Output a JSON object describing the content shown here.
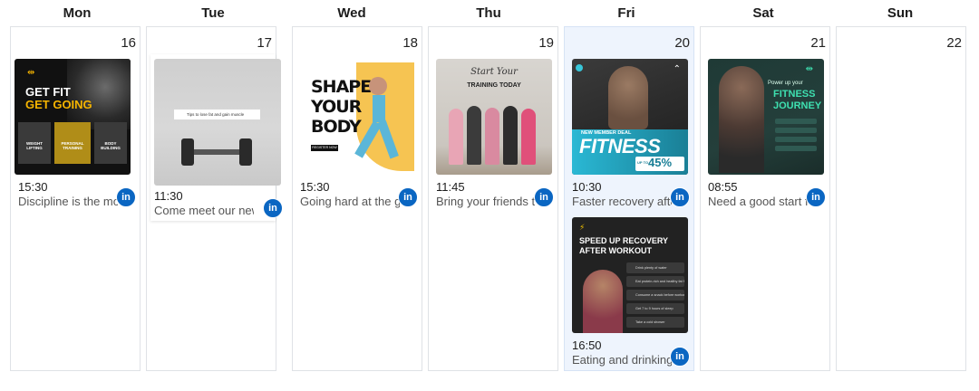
{
  "days": [
    {
      "name": "Mon",
      "date": "16"
    },
    {
      "name": "Tue",
      "date": "17"
    },
    {
      "name": "Wed",
      "date": "18"
    },
    {
      "name": "Thu",
      "date": "19"
    },
    {
      "name": "Fri",
      "date": "20"
    },
    {
      "name": "Sat",
      "date": "21"
    },
    {
      "name": "Sun",
      "date": "22"
    }
  ],
  "today_index": 4,
  "network_icon": "linkedin-icon",
  "network_label": "in",
  "colors": {
    "accent": "#0a66c2",
    "today_bg": "#eef4fd",
    "border": "#dfe2e6"
  },
  "posts": {
    "mon": {
      "time": "15:30",
      "caption": "Discipline is the mo…",
      "img": {
        "line1": "GET FIT",
        "line2": "GET GOING",
        "col1": "WEIGHT LIFTING",
        "col2": "PERSONAL TRAINING",
        "col3": "BODY BUILDING"
      }
    },
    "tue": {
      "time": "11:30",
      "caption": "Come meet our new w…",
      "img": {
        "search": "Tips to lose fat and gain muscle"
      }
    },
    "wed": {
      "time": "15:30",
      "caption": "Going hard at the gy…",
      "img": {
        "line1": "SHAPE",
        "line2": "YOUR",
        "line3": "BODY",
        "cta": "REGISTER NOW"
      }
    },
    "thu": {
      "time": "11:45",
      "caption": "Bring your friends t…",
      "img": {
        "script": "Start Your",
        "line": "TRAINING TODAY"
      }
    },
    "fri1": {
      "time": "10:30",
      "caption": "Faster recovery afte…",
      "img": {
        "tag": "NEW MEMBER DEAL",
        "title": "FITNESS",
        "pct": "45%",
        "upto": "UP TO"
      }
    },
    "fri2": {
      "time": "16:50",
      "caption": "Eating and drinking…",
      "img": {
        "title1": "SPEED UP RECOVERY",
        "title2": "AFTER WORKOUT",
        "tips": [
          "Drink plenty of water",
          "Eat protein-rich and healthy fat food",
          "Consume a snack before workout",
          "Get 7 to 9 hours of sleep",
          "Take a cold shower"
        ]
      }
    },
    "sat": {
      "time": "08:55",
      "caption": "Need a good start fo…",
      "img": {
        "small": "Power up your",
        "title1": "FITNESS",
        "title2": "JOURNEY"
      }
    }
  }
}
